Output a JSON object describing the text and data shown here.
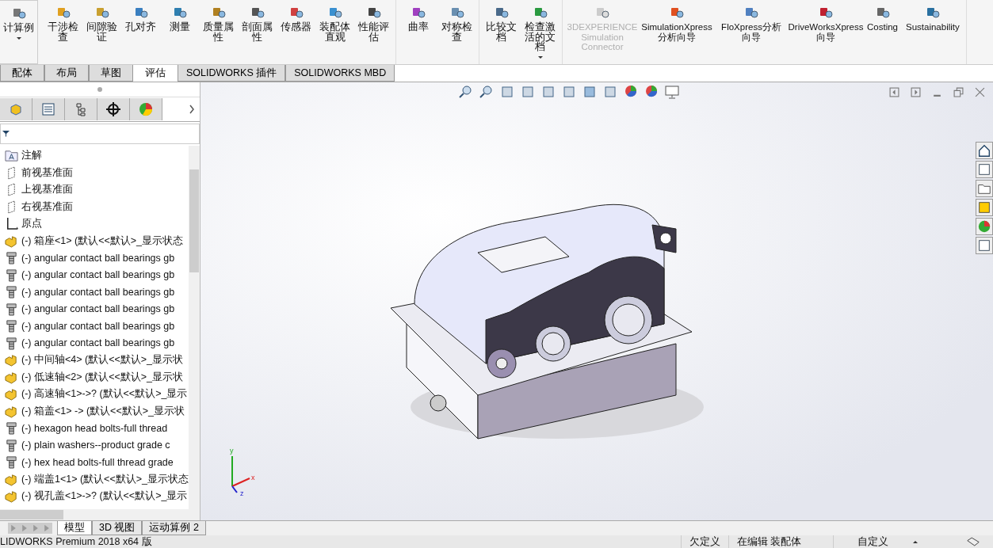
{
  "ribbon": {
    "groups": [
      {
        "items": [
          {
            "label": "计算例",
            "dropdown": true,
            "disabled": false
          }
        ]
      },
      {
        "items": [
          {
            "label": "干涉检查",
            "dropdown": false,
            "disabled": false
          },
          {
            "label": "间隙验证",
            "dropdown": false,
            "disabled": false
          },
          {
            "label": "孔对齐",
            "dropdown": false,
            "disabled": false
          },
          {
            "label": "测量",
            "dropdown": false,
            "disabled": false
          },
          {
            "label": "质量属性",
            "dropdown": false,
            "disabled": false
          },
          {
            "label": "剖面属性",
            "dropdown": false,
            "disabled": false
          },
          {
            "label": "传感器",
            "dropdown": false,
            "disabled": false
          },
          {
            "label": "装配体直观",
            "dropdown": false,
            "disabled": false
          },
          {
            "label": "性能评估",
            "dropdown": false,
            "disabled": false
          }
        ]
      },
      {
        "items": [
          {
            "label": "曲率",
            "dropdown": false,
            "disabled": false
          },
          {
            "label": "对称检查",
            "dropdown": false,
            "disabled": false
          }
        ]
      },
      {
        "items": [
          {
            "label": "比较文档",
            "dropdown": false,
            "disabled": false
          },
          {
            "label": "检查激活的文档",
            "dropdown": true,
            "disabled": false
          }
        ]
      },
      {
        "items": [
          {
            "label": "3DEXPERIENCE Simulation Connector",
            "dropdown": false,
            "disabled": true
          },
          {
            "label": "SimulationXpress分析向导",
            "dropdown": false,
            "disabled": false
          },
          {
            "label": "FloXpress分析向导",
            "dropdown": false,
            "disabled": false
          },
          {
            "label": "DriveWorksXpress向导",
            "dropdown": false,
            "disabled": false
          },
          {
            "label": "Costing",
            "dropdown": false,
            "disabled": false
          },
          {
            "label": "Sustainability",
            "dropdown": false,
            "disabled": false
          }
        ]
      }
    ]
  },
  "tabs": [
    {
      "label": "配体",
      "selected": false
    },
    {
      "label": "布局",
      "selected": false
    },
    {
      "label": "草图",
      "selected": false
    },
    {
      "label": "评估",
      "selected": true
    },
    {
      "label": "SOLIDWORKS 插件",
      "selected": false
    },
    {
      "label": "SOLIDWORKS MBD",
      "selected": false
    }
  ],
  "tree": [
    {
      "kind": "annotation",
      "label": "注解"
    },
    {
      "kind": "plane",
      "label": "前视基准面"
    },
    {
      "kind": "plane",
      "label": "上视基准面"
    },
    {
      "kind": "plane",
      "label": "右视基准面"
    },
    {
      "kind": "origin",
      "label": "原点"
    },
    {
      "kind": "assembly",
      "label": "(-) 箱座<1> (默认<<默认>_显示状态"
    },
    {
      "kind": "part",
      "label": "(-) angular contact ball bearings gb"
    },
    {
      "kind": "part",
      "label": "(-) angular contact ball bearings gb"
    },
    {
      "kind": "part",
      "label": "(-) angular contact ball bearings gb"
    },
    {
      "kind": "part",
      "label": "(-) angular contact ball bearings gb"
    },
    {
      "kind": "part",
      "label": "(-) angular contact ball bearings gb"
    },
    {
      "kind": "part",
      "label": "(-) angular contact ball bearings gb"
    },
    {
      "kind": "assembly",
      "label": "(-) 中间轴<4> (默认<<默认>_显示状"
    },
    {
      "kind": "assembly",
      "label": "(-) 低速轴<2> (默认<<默认>_显示状"
    },
    {
      "kind": "assembly",
      "label": "(-) 高速轴<1>->? (默认<<默认>_显示"
    },
    {
      "kind": "assembly",
      "label": "(-) 箱盖<1> -> (默认<<默认>_显示状"
    },
    {
      "kind": "part",
      "label": "(-) hexagon head bolts-full thread"
    },
    {
      "kind": "part",
      "label": "(-) plain washers--product grade c"
    },
    {
      "kind": "part",
      "label": "(-) hex head bolts-full thread grade"
    },
    {
      "kind": "assembly",
      "label": "(-) 端盖1<1> (默认<<默认>_显示状态"
    },
    {
      "kind": "assembly",
      "label": "(-) 视孔盖<1>->? (默认<<默认>_显示"
    }
  ],
  "triad": {
    "y": "y",
    "x": "x",
    "z": "z"
  },
  "bottom_tabs": [
    {
      "label": "模型",
      "selected": true
    },
    {
      "label": "3D 视图",
      "selected": false
    },
    {
      "label": "运动算例 2",
      "selected": false
    }
  ],
  "status_bar": {
    "product": "LIDWORKS Premium 2018 x64 版",
    "state": "欠定义",
    "editing": "在编辑 装配体",
    "units": "自定义"
  }
}
